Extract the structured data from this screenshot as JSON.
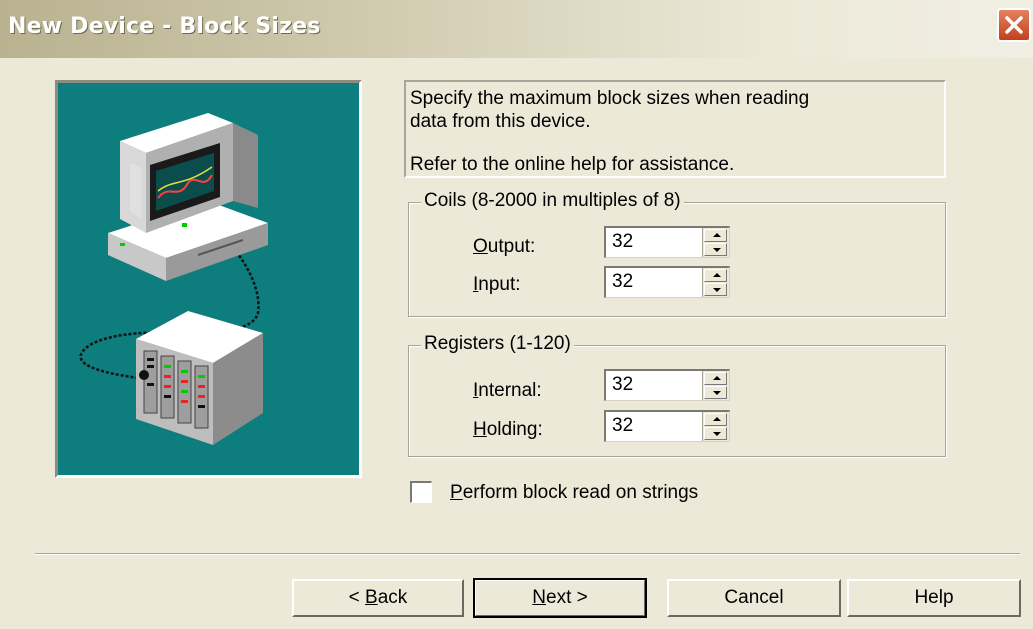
{
  "window": {
    "title": "New Device - Block Sizes",
    "close_icon": "close-x-icon"
  },
  "illustration": {
    "name": "computer-connected-to-device-rack-illustration",
    "background_color": "#0e7d7d"
  },
  "description": {
    "line1": "Specify the maximum block sizes when reading",
    "line2": "data from this device.",
    "line3": "Refer to the online help for assistance."
  },
  "coils": {
    "legend": "Coils (8-2000 in multiples of 8)",
    "output": {
      "label_mnemonic": "O",
      "label_rest": "utput:",
      "value": "32"
    },
    "input": {
      "label_mnemonic": "I",
      "label_rest": "nput:",
      "value": "32"
    }
  },
  "registers": {
    "legend": "Registers (1-120)",
    "internal": {
      "label_mnemonic": "I",
      "label_rest": "nternal:",
      "value": "32"
    },
    "holding": {
      "label_mnemonic": "H",
      "label_rest": "olding:",
      "value": "32"
    }
  },
  "block_read_strings": {
    "label_mnemonic": "P",
    "label_rest": "erform block read on strings",
    "checked": false
  },
  "buttons": {
    "back": {
      "prefix": "< ",
      "mnemonic": "B",
      "rest": "ack"
    },
    "next": {
      "prefix": "",
      "mnemonic": "N",
      "rest": "ext >"
    },
    "cancel": "Cancel",
    "help": "Help"
  }
}
